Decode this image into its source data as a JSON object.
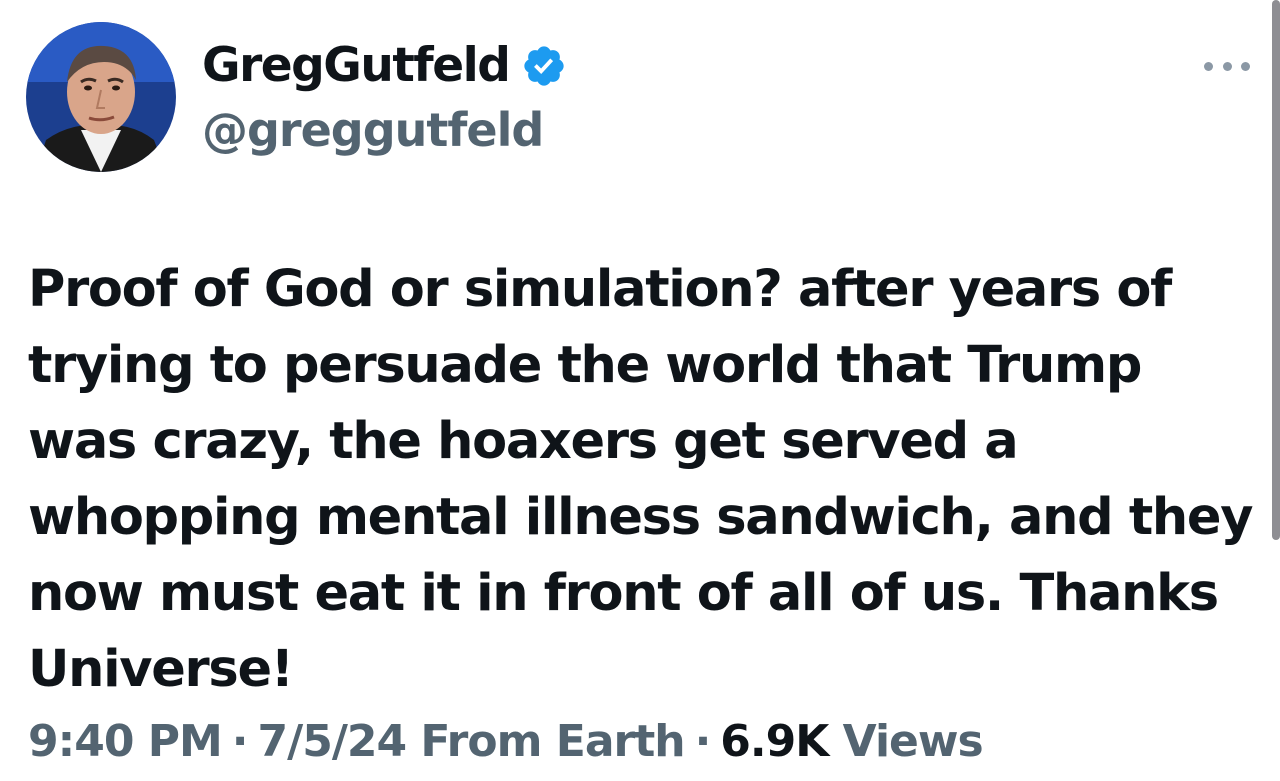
{
  "tweet": {
    "author": {
      "display_name": "GregGutfeld",
      "handle": "@greggutfeld",
      "verified": true
    },
    "text": "Proof of God or simulation? after years of trying to persuade the world that Trump was crazy, the hoaxers get served a whopping mental illness sandwich, and they now must eat it in front of all of us. Thanks Universe!",
    "time": "9:40 PM",
    "separator": "·",
    "date_source": "7/5/24 From Earth",
    "views_count": "6.9K",
    "views_label": "Views"
  },
  "icons": {
    "verified": "verified-badge-icon",
    "more": "more-options-icon"
  },
  "colors": {
    "verified_blue": "#1d9bf0",
    "secondary_text": "#536471",
    "primary_text": "#0f1419"
  }
}
